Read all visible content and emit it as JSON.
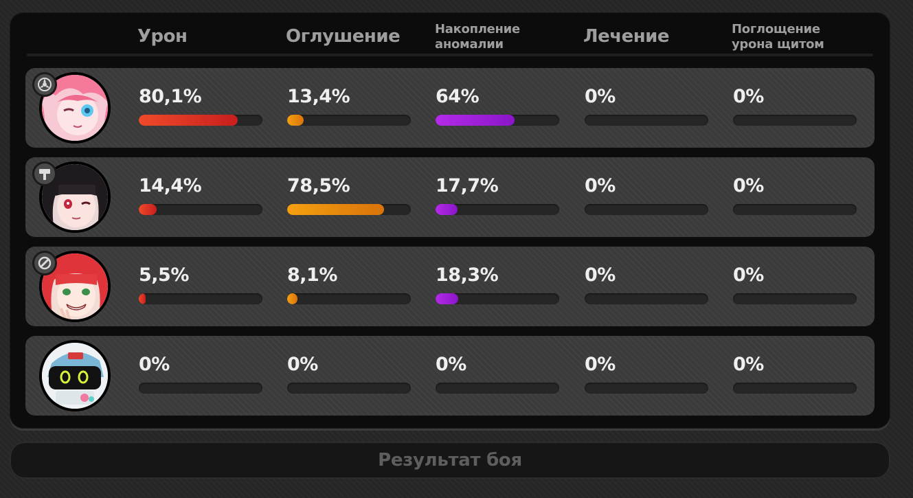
{
  "headers": {
    "damage": "Урон",
    "stun": "Оглушение",
    "anomaly": "Накопление аномалии",
    "healing": "Лечение",
    "shield": "Поглощение урона щитом"
  },
  "colors": {
    "damage": "#e8352a",
    "stun": "#e88c0c",
    "anomaly": "#a323e0",
    "healing": "#4cc15a",
    "shield": "#3a8ee8"
  },
  "members": [
    {
      "name_icon": "pink-haired-agent-portrait",
      "specialty_icon": "anomaly-specialty-icon",
      "damage": {
        "text": "80,1%",
        "value": 80.1
      },
      "stun": {
        "text": "13,4%",
        "value": 13.4
      },
      "anomaly": {
        "text": "64%",
        "value": 64
      },
      "healing": {
        "text": "0%",
        "value": 0
      },
      "shield": {
        "text": "0%",
        "value": 0
      }
    },
    {
      "name_icon": "dark-haired-agent-portrait",
      "specialty_icon": "stun-specialty-icon",
      "damage": {
        "text": "14,4%",
        "value": 14.4
      },
      "stun": {
        "text": "78,5%",
        "value": 78.5
      },
      "anomaly": {
        "text": "17,7%",
        "value": 17.7
      },
      "healing": {
        "text": "0%",
        "value": 0
      },
      "shield": {
        "text": "0%",
        "value": 0
      }
    },
    {
      "name_icon": "red-haired-agent-portrait",
      "specialty_icon": "support-specialty-icon",
      "damage": {
        "text": "5,5%",
        "value": 5.5
      },
      "stun": {
        "text": "8,1%",
        "value": 8.1
      },
      "anomaly": {
        "text": "18,3%",
        "value": 18.3
      },
      "healing": {
        "text": "0%",
        "value": 0
      },
      "shield": {
        "text": "0%",
        "value": 0
      }
    },
    {
      "name_icon": "bangboo-portrait",
      "specialty_icon": "",
      "damage": {
        "text": "0%",
        "value": 0
      },
      "stun": {
        "text": "0%",
        "value": 0
      },
      "anomaly": {
        "text": "0%",
        "value": 0
      },
      "healing": {
        "text": "0%",
        "value": 0
      },
      "shield": {
        "text": "0%",
        "value": 0
      }
    }
  ],
  "footer": {
    "result_label": "Результат боя"
  }
}
